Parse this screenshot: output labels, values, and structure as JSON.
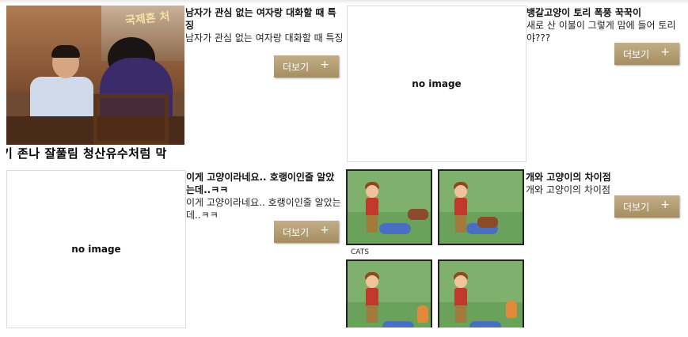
{
  "cards": [
    {
      "title": "남자가 관심 없는 여자랑 대화할 때 특징",
      "desc": " 남자가 관심 없는 여자랑 대화할 때 특징",
      "more_label": "더보기",
      "more_icon": "+",
      "thumb": {
        "type": "photo",
        "overlay_logo": "국제혼 처",
        "caption": "기 존나 잘풀림 청산유수처럼 막"
      }
    },
    {
      "title": "뱅갈고양이 토리 폭풍 꾹꾹이",
      "desc": " 새로 산 이불이 그렇게 맘에 들어 토리야???",
      "more_label": "더보기",
      "more_icon": "+",
      "thumb": {
        "type": "no-image",
        "label": "no image"
      }
    },
    {
      "title": "이게 고양이라네요.. 호랭이인줄 알았는데..ㅋㅋ",
      "desc": " 이게 고양이라네요..  호랭이인줄 알았는데..ㅋㅋ",
      "more_label": "더보기",
      "more_icon": "+",
      "thumb": {
        "type": "no-image",
        "label": "no image"
      }
    },
    {
      "title": "개와 고양이의 차이점",
      "desc": "개와 고양이의 차이점",
      "more_label": "더보기",
      "more_icon": "+",
      "thumb": {
        "type": "comic",
        "panel_label": "CATS"
      }
    }
  ],
  "colors": {
    "more_button_top": "#c2ae87",
    "more_button_bottom": "#a58d61",
    "no_image_border": "#dcdcdc"
  }
}
